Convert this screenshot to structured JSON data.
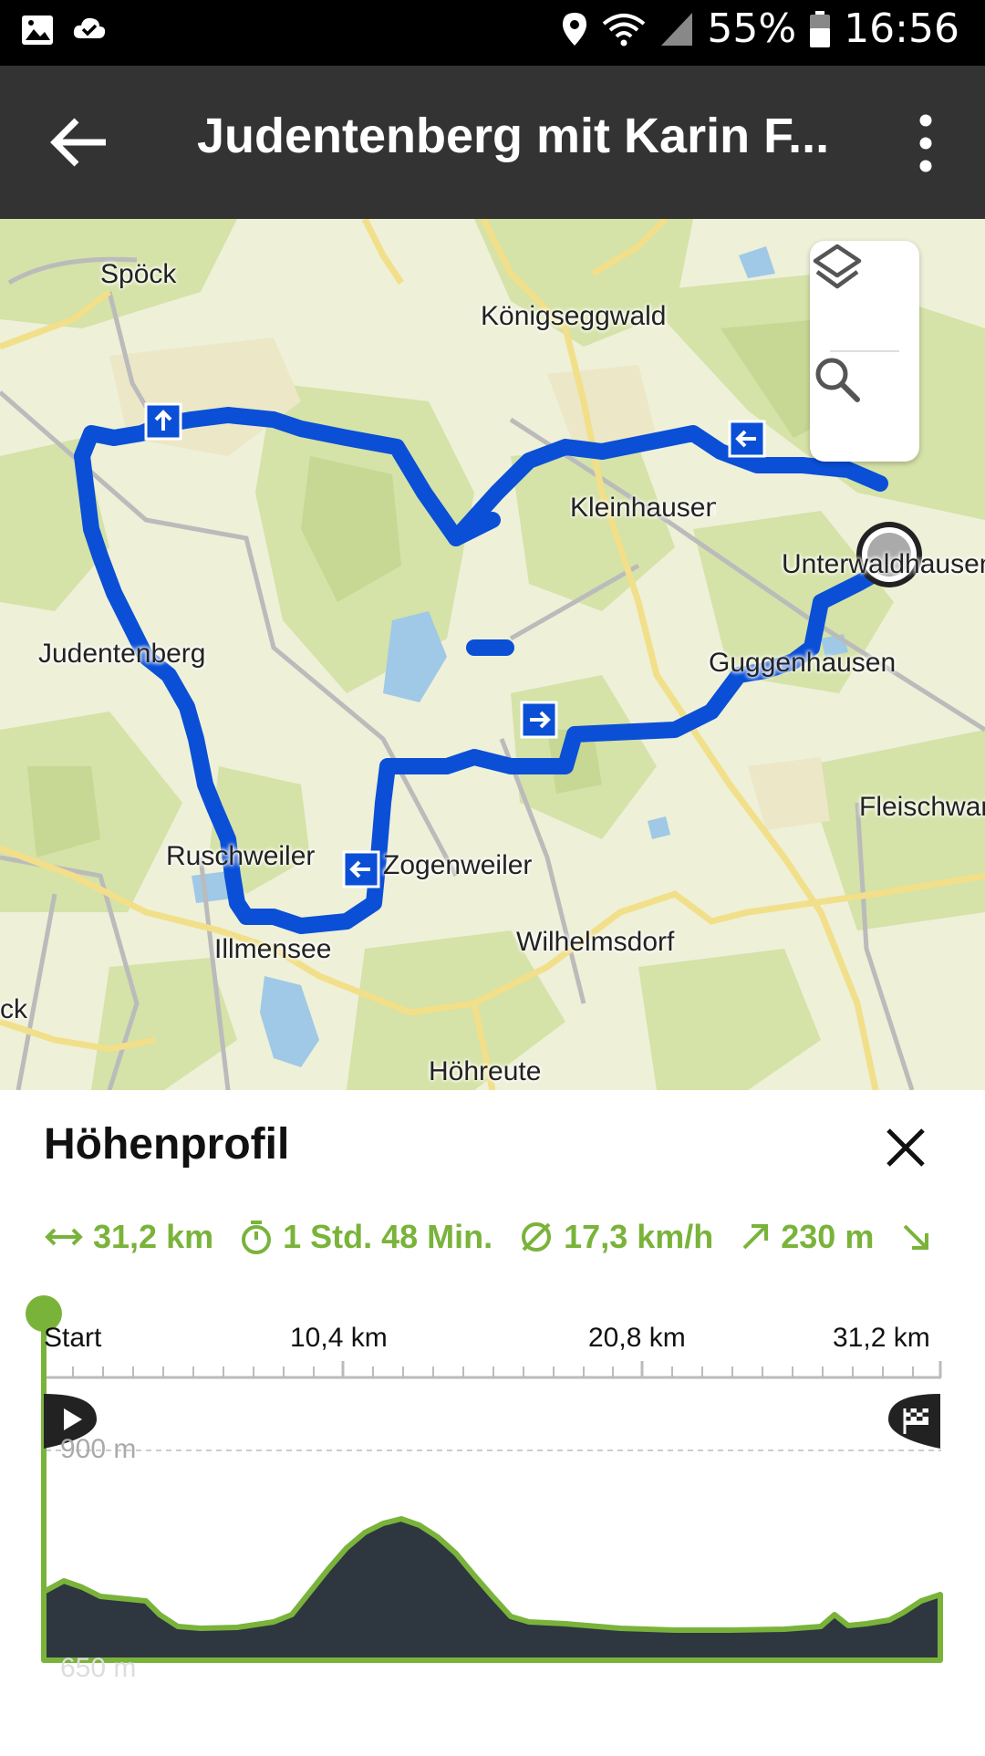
{
  "status_bar": {
    "battery": "55%",
    "time": "16:56",
    "icons": [
      "image-icon",
      "cloud-check-icon",
      "location-icon",
      "wifi-icon",
      "signal-icon",
      "battery-icon"
    ]
  },
  "app_bar": {
    "title": "Judentenberg mit Karin F...",
    "icons": [
      "back-arrow-icon",
      "more-vert-icon"
    ]
  },
  "map": {
    "labels": [
      "Spöck",
      "Königseggwald",
      "Kleinhausen",
      "Unterwaldhausen",
      "Judentenberg",
      "Guggenhausen",
      "Fleischwangen",
      "Ruschweiler",
      "Zogenweiler",
      "Illmensee",
      "Wilhelmsdorf",
      "Höhreute",
      "ck"
    ],
    "route_color": "#0a4fd6",
    "controls": [
      "layers-icon",
      "search-icon"
    ]
  },
  "panel": {
    "title": "Höhenprofil",
    "stats": [
      {
        "icon": "distance-icon",
        "value": "31,2 km"
      },
      {
        "icon": "timer-icon",
        "value": "1 Std. 48 Min."
      },
      {
        "icon": "average-speed-icon",
        "value": "17,3 km/h"
      },
      {
        "icon": "ascent-icon",
        "value": "230 m"
      }
    ],
    "profile": {
      "x_labels": [
        "Start",
        "10,4 km",
        "20,8 km",
        "31,2 km"
      ],
      "y_labels": [
        "900 m",
        "650 m"
      ],
      "accent": "#7ab33a",
      "fill": "#2e3640"
    }
  }
}
